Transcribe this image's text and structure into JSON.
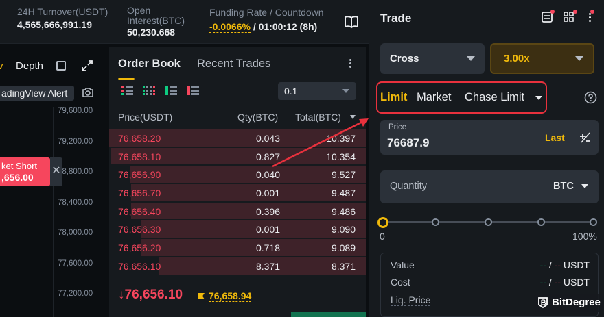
{
  "stats": {
    "turnover_label": "24H Turnover(USDT)",
    "turnover_value": "4,565,666,991.19",
    "oi_label_line1": "Open",
    "oi_label_line2": "Interest(BTC)",
    "oi_value": "50,230.668",
    "funding_label": "Funding Rate / Countdown",
    "funding_rate": "-0.0066%",
    "funding_sep": " / ",
    "countdown": "01:00:12 (8h)"
  },
  "chart": {
    "tab_partial": "v",
    "tab_depth": "Depth",
    "tv_alert": "adingView Alert",
    "y_labels": [
      "79,600.00",
      "79,200.00",
      "78,800.00",
      "78,400.00",
      "78,000.00",
      "77,600.00",
      "77,200.00"
    ],
    "market_short_label": "ket Short",
    "market_short_price": ",656.00"
  },
  "order_book": {
    "tab_active": "Order Book",
    "tab_other": "Recent Trades",
    "tick_size": "0.1",
    "headers": {
      "price": "Price(USDT)",
      "qty": "Qty(BTC)",
      "total": "Total(BTC)"
    },
    "asks": [
      {
        "price": "76,658.20",
        "qty": "0.043",
        "total": "10.397",
        "depth": 1.0
      },
      {
        "price": "76,658.10",
        "qty": "0.827",
        "total": "10.354",
        "depth": 0.995
      },
      {
        "price": "76,656.90",
        "qty": "0.040",
        "total": "9.527",
        "depth": 0.92
      },
      {
        "price": "76,656.70",
        "qty": "0.001",
        "total": "9.487",
        "depth": 0.915
      },
      {
        "price": "76,656.40",
        "qty": "0.396",
        "total": "9.486",
        "depth": 0.915
      },
      {
        "price": "76,656.30",
        "qty": "0.001",
        "total": "9.090",
        "depth": 0.875
      },
      {
        "price": "76,656.20",
        "qty": "0.718",
        "total": "9.089",
        "depth": 0.875
      },
      {
        "price": "76,656.10",
        "qty": "8.371",
        "total": "8.371",
        "depth": 0.805
      }
    ],
    "last_price": "↓76,656.10",
    "mark_price": "76,658.94"
  },
  "trade": {
    "title": "Trade",
    "margin_mode": "Cross",
    "leverage": "3.00x",
    "order_types": {
      "limit": "Limit",
      "market": "Market",
      "chase": "Chase Limit"
    },
    "price_label": "Price",
    "price_value": "76687.9",
    "last_label": "Last",
    "qty_label": "Quantity",
    "qty_unit": "BTC",
    "slider_min": "0",
    "slider_max": "100%",
    "slider_level": 0,
    "value_label": "Value",
    "cost_label": "Cost",
    "liq_label": "Liq. Price",
    "dash_long": "--",
    "dash_sep": " / ",
    "dash_short": "--",
    "unit": "USDT",
    "brand": "BitDegree"
  },
  "colors": {
    "accent": "#f0b90b",
    "sell": "#f6465d",
    "buy": "#0ecb81",
    "annotation": "#e8313d"
  }
}
